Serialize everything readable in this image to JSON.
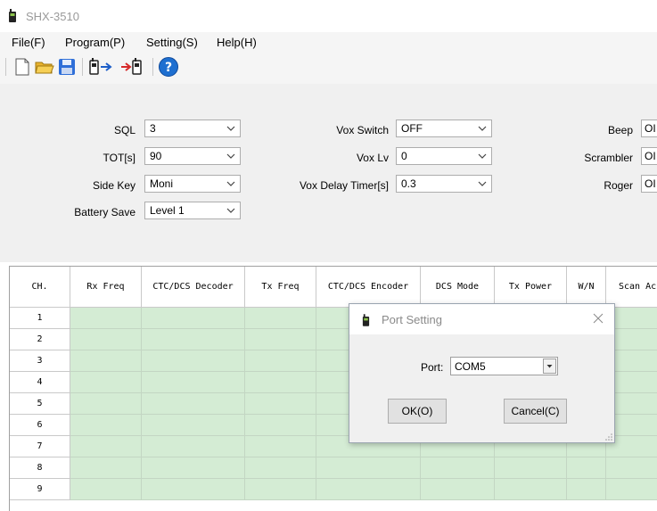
{
  "window": {
    "title": "SHX-3510"
  },
  "menu": [
    "File(F)",
    "Program(P)",
    "Setting(S)",
    "Help(H)"
  ],
  "toolbar_icons": [
    "new-file-icon",
    "open-folder-icon",
    "save-icon",
    "read-radio-icon",
    "write-radio-icon",
    "help-icon"
  ],
  "settings": {
    "sql": {
      "label": "SQL",
      "value": "3"
    },
    "tot": {
      "label": "TOT[s]",
      "value": "90"
    },
    "side_key": {
      "label": "Side Key",
      "value": "Moni"
    },
    "battery_save": {
      "label": "Battery Save",
      "value": "Level 1"
    },
    "vox_switch": {
      "label": "Vox Switch",
      "value": "OFF"
    },
    "vox_lv": {
      "label": "Vox Lv",
      "value": "0"
    },
    "vox_delay": {
      "label": "Vox Delay Timer[s]",
      "value": "0.3"
    },
    "beep": {
      "label": "Beep",
      "value": "OI"
    },
    "scrambler": {
      "label": "Scrambler",
      "value": "OI"
    },
    "roger": {
      "label": "Roger",
      "value": "OI"
    }
  },
  "grid": {
    "columns": [
      "CH.",
      "Rx Freq",
      "CTC/DCS Decoder",
      "Tx Freq",
      "CTC/DCS Encoder",
      "DCS Mode",
      "Tx Power",
      "W/N",
      "Scan Ac"
    ],
    "rows": [
      "1",
      "2",
      "3",
      "4",
      "5",
      "6",
      "7",
      "8",
      "9"
    ]
  },
  "dialog": {
    "title": "Port Setting",
    "port_label": "Port:",
    "port_value": "COM5",
    "ok_label": "OK(O)",
    "cancel_label": "Cancel(C)"
  },
  "colors": {
    "grid_cell": "#d4ecd4",
    "panel": "#f0f0f0",
    "help_icon": "#1e6fd0"
  }
}
